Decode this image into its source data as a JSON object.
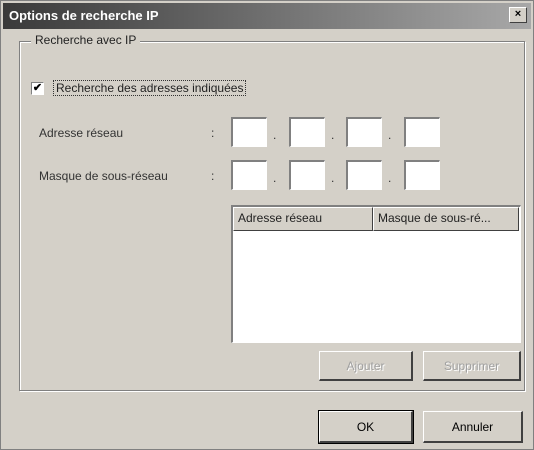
{
  "window": {
    "title": "Options de recherche IP",
    "close_glyph": "×"
  },
  "group": {
    "label": "Recherche avec IP"
  },
  "checkbox": {
    "label": "Recherche des adresses indiquées",
    "checked": true,
    "check_glyph": "✔"
  },
  "fields": {
    "network_address_label": "Adresse réseau",
    "subnet_mask_label": "Masque de sous-réseau",
    "colon": ":",
    "dot": ".",
    "network_address_octets": [
      "",
      "",
      "",
      ""
    ],
    "subnet_mask_octets": [
      "",
      "",
      "",
      ""
    ]
  },
  "list": {
    "columns": [
      "Adresse réseau",
      "Masque de sous-ré..."
    ],
    "rows": []
  },
  "buttons": {
    "add": "Ajouter",
    "delete": "Supprimer",
    "ok": "OK",
    "cancel": "Annuler"
  }
}
